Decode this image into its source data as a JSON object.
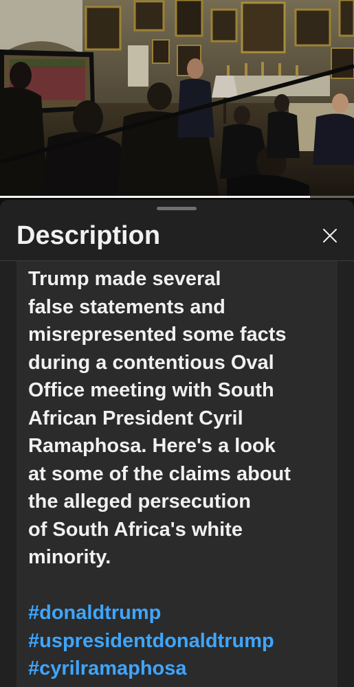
{
  "video": {
    "progress_fraction": 0.875
  },
  "panel": {
    "title": "Description",
    "close_icon": "close-icon"
  },
  "description": {
    "lines": [
      "Trump made several",
      "false statements and",
      "misrepresented some facts",
      "during a contentious Oval",
      "Office meeting with South",
      "African President Cyril",
      "Ramaphosa. Here's a look",
      "at some of the claims about",
      "the alleged persecution",
      "of South Africa's white",
      "minority."
    ],
    "hashtags": [
      "#donaldtrump",
      "#uspresidentdonaldtrump",
      "#cyrilramaphosa"
    ]
  },
  "colors": {
    "sheet_background": "#212121",
    "text": "#f1f1f1",
    "hashtag": "#3ea6ff"
  }
}
